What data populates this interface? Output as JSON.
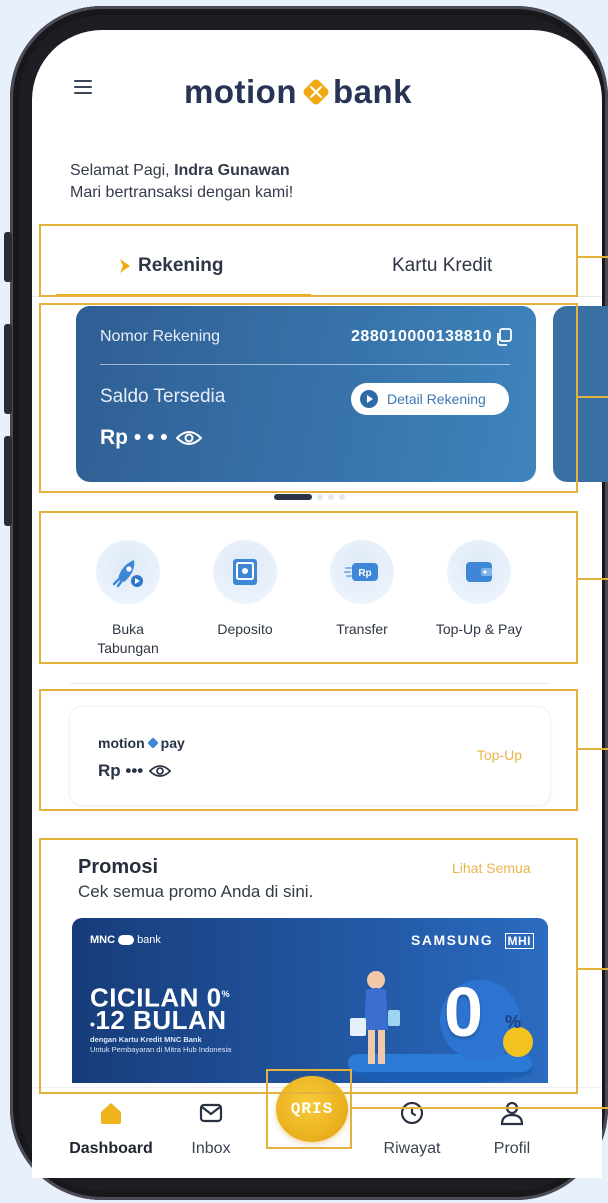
{
  "app": {
    "logo_left": "motion",
    "logo_right": "bank"
  },
  "header": {
    "menu_icon": "hamburger-icon"
  },
  "greeting": {
    "salutation": "Selamat Pagi, ",
    "name": "Indra Gunawan",
    "subtitle": "Mari bertransaksi dengan kami!"
  },
  "tabs": [
    {
      "label": "Rekening",
      "active": true
    },
    {
      "label": "Kartu Kredit",
      "active": false
    }
  ],
  "account_card": {
    "number_label": "Nomor Rekening",
    "number_value": "288010000138810",
    "balance_label": "Saldo Tersedia",
    "balance_masked": "Rp • • •",
    "detail_button": "Detail Rekening"
  },
  "carousel": {
    "total": 4,
    "active": 1
  },
  "quick_menu": [
    {
      "label": "Buka\nTabungan",
      "icon": "rocket-icon"
    },
    {
      "label": "Deposito",
      "icon": "safe-icon"
    },
    {
      "label": "Transfer",
      "icon": "transfer-icon"
    },
    {
      "label": "Top-Up & Pay",
      "icon": "wallet-icon"
    }
  ],
  "motionpay": {
    "logo_left": "motion",
    "logo_right": "pay",
    "balance_masked": "Rp •••",
    "topup_link": "Top-Up"
  },
  "promo": {
    "title": "Promosi",
    "subtitle": "Cek semua promo Anda di sini.",
    "see_all": "Lihat Semua",
    "banner": {
      "brand_left": "MNC",
      "brand_right": "bank",
      "partner": "SAMSUNG",
      "partner2": "MHI",
      "headline_1": "CICILAN 0",
      "headline_2": "12 BULAN",
      "fine_1": "dengan Kartu Kredit MNC Bank",
      "fine_2": "Untuk Pembayaran di Mitra Hub Indonesia",
      "big_zero": "0",
      "percent": "%"
    }
  },
  "bottom_nav": [
    {
      "label": "Dashboard",
      "icon": "home-icon",
      "active": true
    },
    {
      "label": "Inbox",
      "icon": "mail-icon",
      "active": false
    },
    {
      "label": "Riwayat",
      "icon": "clock-icon",
      "active": false
    },
    {
      "label": "Profil",
      "icon": "user-icon",
      "active": false
    }
  ],
  "qris": {
    "label": "QRIS"
  },
  "colors": {
    "accent": "#f0a913",
    "brand_dark": "#283454",
    "card_blue": "#3a78b0",
    "link": "#eab44a"
  }
}
